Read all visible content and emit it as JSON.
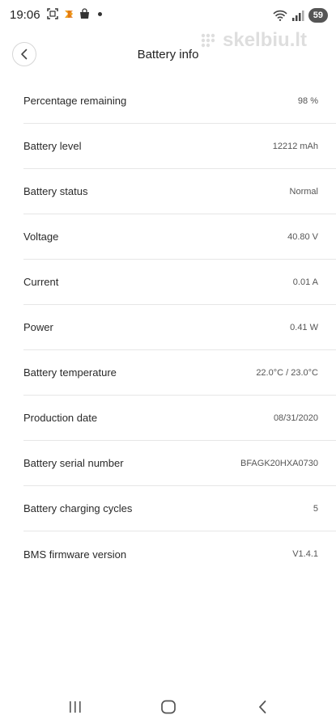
{
  "status_bar": {
    "time": "19:06",
    "battery": "59",
    "icons_left": [
      "screenshot-icon",
      "app-icon",
      "shopping-bag-icon",
      "notification-dot-icon"
    ],
    "icons_right": [
      "wifi-icon",
      "signal-icon",
      "battery-icon"
    ]
  },
  "watermark": {
    "text": "skelbiu.lt"
  },
  "header": {
    "title": "Battery info",
    "back_icon": "chevron-left-icon"
  },
  "items": [
    {
      "label": "Percentage remaining",
      "value": "98 %"
    },
    {
      "label": "Battery level",
      "value": "12212 mAh"
    },
    {
      "label": "Battery status",
      "value": "Normal"
    },
    {
      "label": "Voltage",
      "value": "40.80 V"
    },
    {
      "label": "Current",
      "value": "0.01 A"
    },
    {
      "label": "Power",
      "value": "0.41 W"
    },
    {
      "label": "Battery temperature",
      "value": "22.0°C / 23.0°C"
    },
    {
      "label": "Production date",
      "value": "08/31/2020"
    },
    {
      "label": "Battery serial number",
      "value": "BFAGK20HXA0730"
    },
    {
      "label": "Battery charging cycles",
      "value": "5"
    },
    {
      "label": "BMS firmware version",
      "value": "V1.4.1"
    }
  ],
  "nav_bar": {
    "recents_icon": "recents-icon",
    "home_icon": "home-icon",
    "back_icon": "back-icon"
  },
  "colors": {
    "text": "#222222",
    "value_text": "#555555",
    "divider": "#e6e6e6",
    "battery_pill": "#555555"
  }
}
